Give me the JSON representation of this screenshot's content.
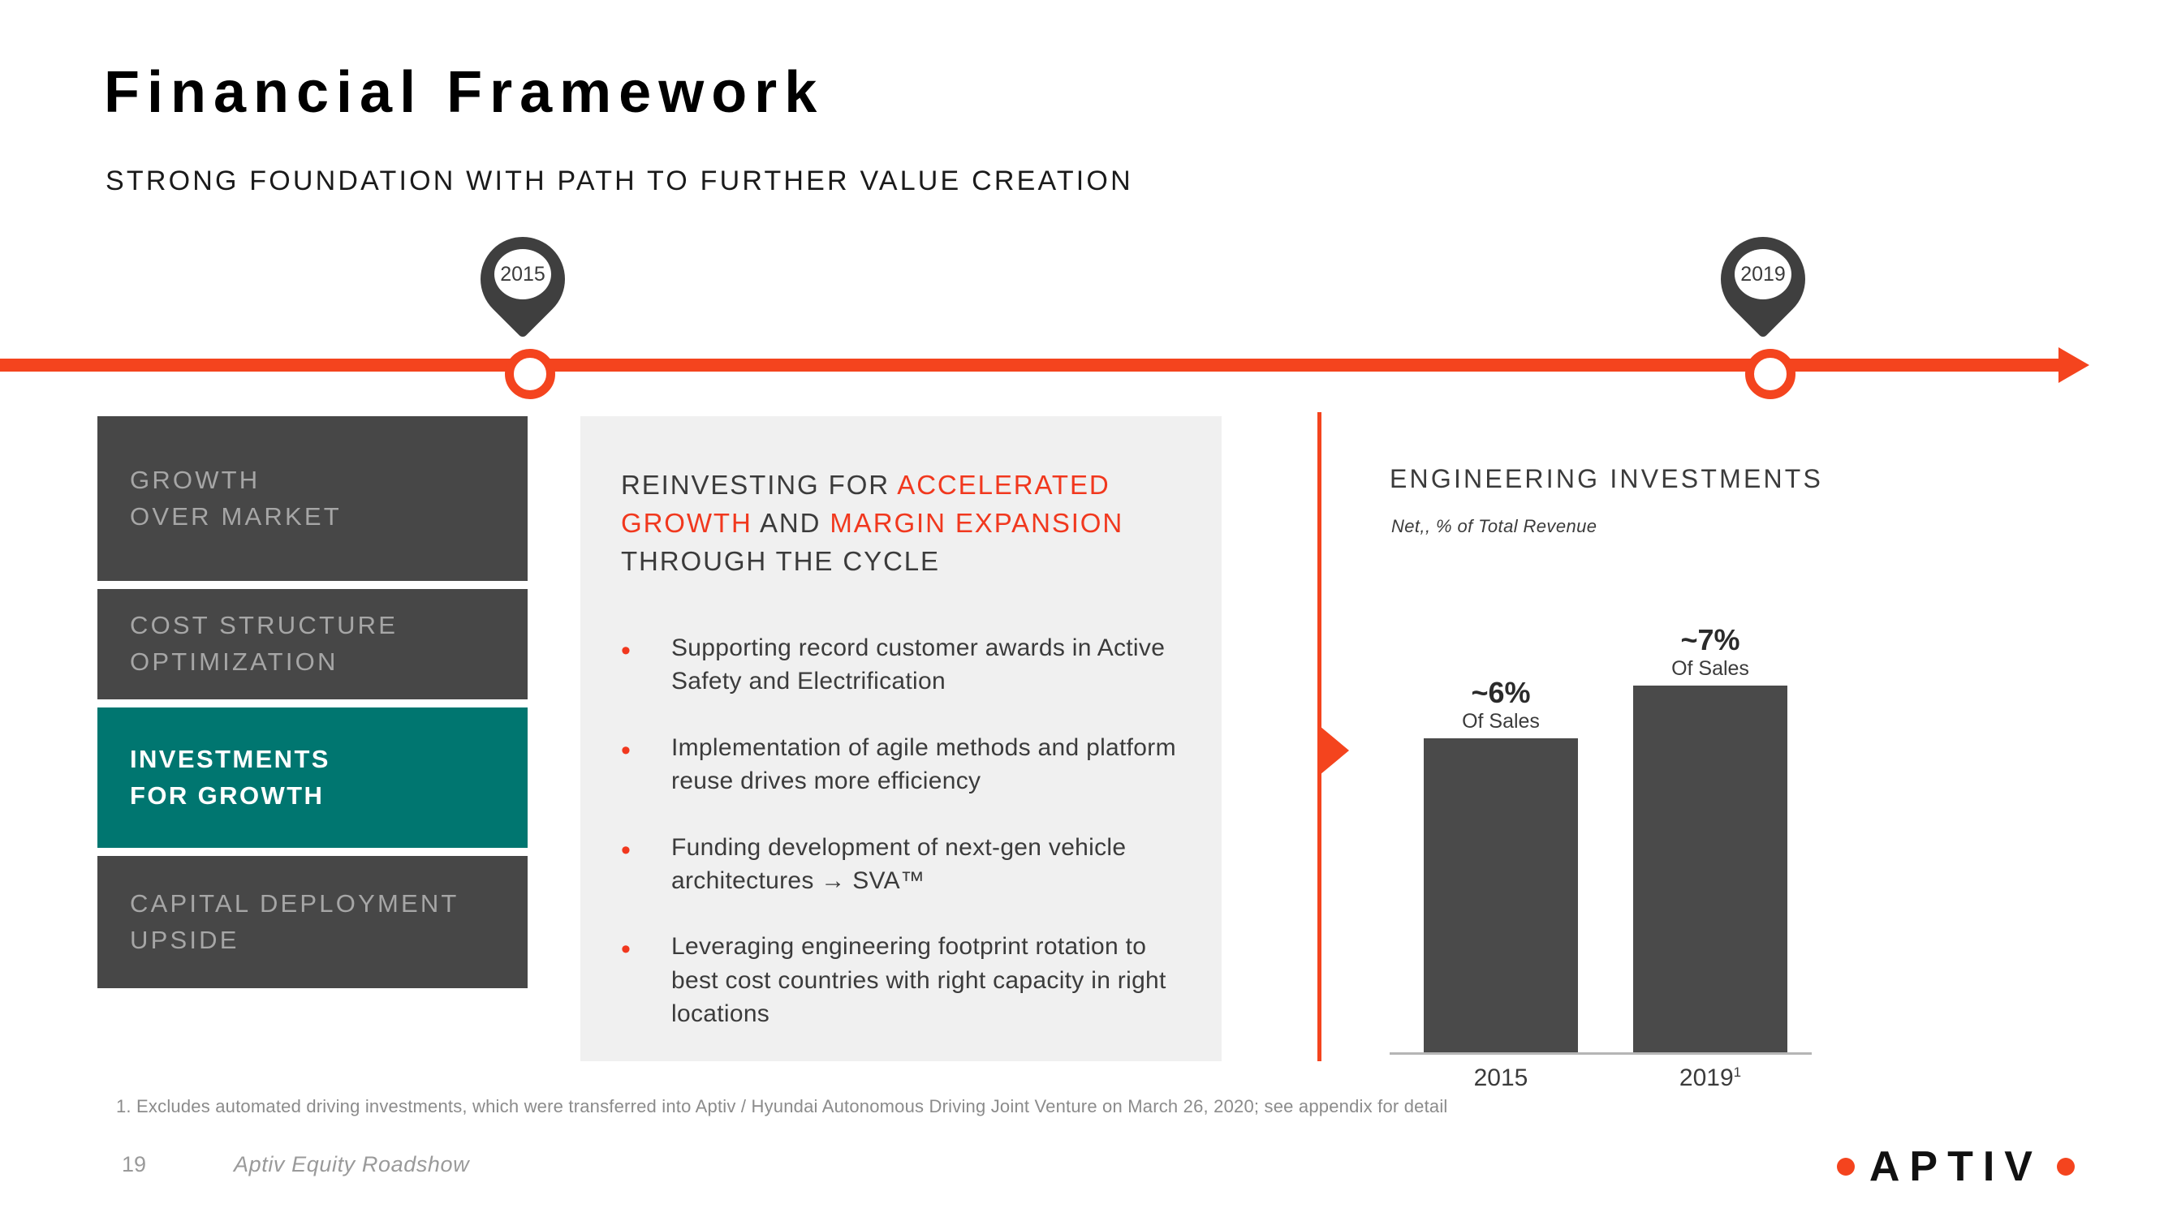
{
  "header": {
    "title": "Financial Framework",
    "subtitle": "STRONG FOUNDATION WITH PATH TO FURTHER VALUE CREATION"
  },
  "timeline": {
    "markers": [
      {
        "label": "2015"
      },
      {
        "label": "2019"
      }
    ]
  },
  "pillars": [
    {
      "line1": "GROWTH",
      "line2": "OVER MARKET",
      "active": false
    },
    {
      "line1": "COST STRUCTURE",
      "line2": "OPTIMIZATION",
      "active": false
    },
    {
      "line1": "INVESTMENTS",
      "line2": "FOR GROWTH",
      "active": true
    },
    {
      "line1": "CAPITAL DEPLOYMENT",
      "line2": "UPSIDE",
      "active": false
    }
  ],
  "center": {
    "heading_parts": [
      {
        "text": "REINVESTING FOR ",
        "highlight": false
      },
      {
        "text": "ACCELERATED GROWTH",
        "highlight": true
      },
      {
        "text": " AND ",
        "highlight": false
      },
      {
        "text": "MARGIN EXPANSION",
        "highlight": true
      },
      {
        "text": " THROUGH THE CYCLE",
        "highlight": false
      }
    ],
    "bullet_marker": "•",
    "bullets": [
      "Supporting record customer awards in Active Safety and Electrification",
      "Implementation of agile methods and platform reuse drives more efficiency",
      "Funding development of next-gen vehicle architectures → SVA™",
      "Leveraging engineering footprint rotation to best cost countries with right capacity in right locations"
    ]
  },
  "chart_data": {
    "type": "bar",
    "title": "ENGINEERING INVESTMENTS",
    "subtitle": "Net,, % of Total Revenue",
    "categories": [
      "2015",
      "2019"
    ],
    "category_superscripts": [
      "",
      "1"
    ],
    "values": [
      6,
      7
    ],
    "value_labels": [
      "~6%",
      "~7%"
    ],
    "value_sublabels": [
      "Of Sales",
      "Of Sales"
    ],
    "ylabel": "",
    "xlabel": "",
    "ylim": [
      0,
      8
    ],
    "grid": false,
    "legend": false,
    "bar_color": "#4A4A4A"
  },
  "footer": {
    "footnote": "1. Excludes automated driving investments, which were transferred into Aptiv / Hyundai Autonomous Driving Joint Venture on March 26, 2020; see appendix for detail",
    "page_number": "19",
    "deck_name": "Aptiv Equity Roadshow",
    "logo_text": "APTIV"
  },
  "colors": {
    "accent_orange": "#F4441E",
    "highlight_orange": "#F1381E",
    "teal": "#007670",
    "dark_gray": "#474747",
    "bar_gray": "#4A4A4A"
  }
}
